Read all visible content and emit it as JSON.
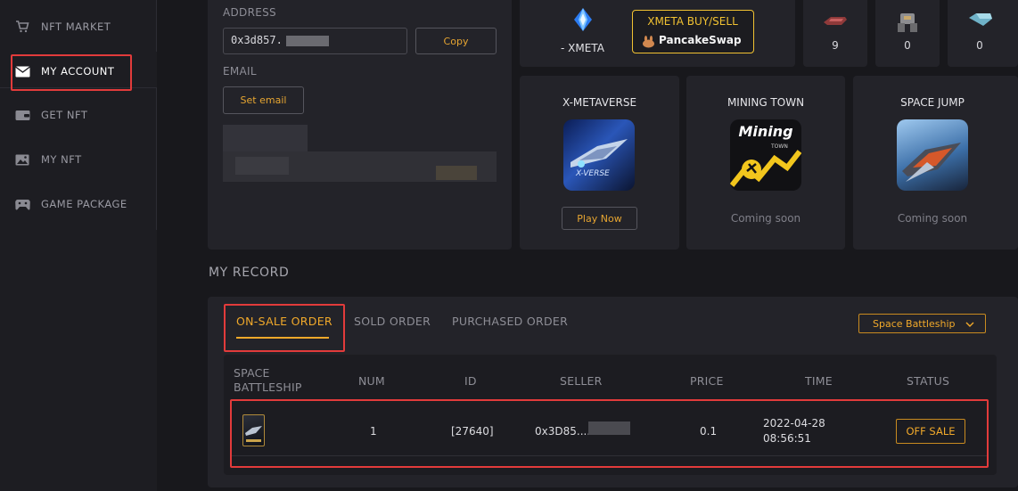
{
  "sidebar": {
    "items": [
      {
        "label": "NFT MARKET",
        "icon": "cart-icon"
      },
      {
        "label": "MY ACCOUNT",
        "icon": "envelope-icon"
      },
      {
        "label": "GET NFT",
        "icon": "wallet-icon"
      },
      {
        "label": "MY NFT",
        "icon": "image-icon"
      },
      {
        "label": "GAME PACKAGE",
        "icon": "gamepad-icon"
      }
    ]
  },
  "account": {
    "address_label": "ADDRESS",
    "address_value": "0x3d857.",
    "copy_label": "Copy",
    "email_label": "EMAIL",
    "set_email_label": "Set email"
  },
  "token": {
    "xmeta_balance": "- XMETA",
    "buy_sell_label": "XMETA BUY/SELL",
    "pancake_label": "PancakeSwap"
  },
  "items": {
    "counts": [
      "9",
      "0",
      "0"
    ]
  },
  "games": [
    {
      "title": "X-METAVERSE",
      "action": "Play Now",
      "thumb_text": "X-VERSE"
    },
    {
      "title": "MINING TOWN",
      "status": "Coming soon",
      "thumb_text": "Mining",
      "thumb_sub": "TOWN"
    },
    {
      "title": "SPACE JUMP",
      "status": "Coming soon"
    }
  ],
  "record": {
    "title": "MY RECORD",
    "tabs": [
      "ON-SALE ORDER",
      "SOLD ORDER",
      "PURCHASED ORDER"
    ],
    "filter_value": "Space Battleship",
    "columns": [
      "SPACE BATTLESHIP",
      "NUM",
      "ID",
      "SELLER",
      "PRICE",
      "TIME",
      "STATUS"
    ],
    "rows": [
      {
        "num": "1",
        "id": "[27640]",
        "seller": "0x3D85....",
        "price": "0.1",
        "date": "2022-04-28",
        "time": "08:56:51",
        "status": "OFF SALE"
      }
    ]
  },
  "colors": {
    "accent": "#f1a92a",
    "highlight": "#e23b3b",
    "background": "#18181c",
    "panel": "#232329"
  }
}
